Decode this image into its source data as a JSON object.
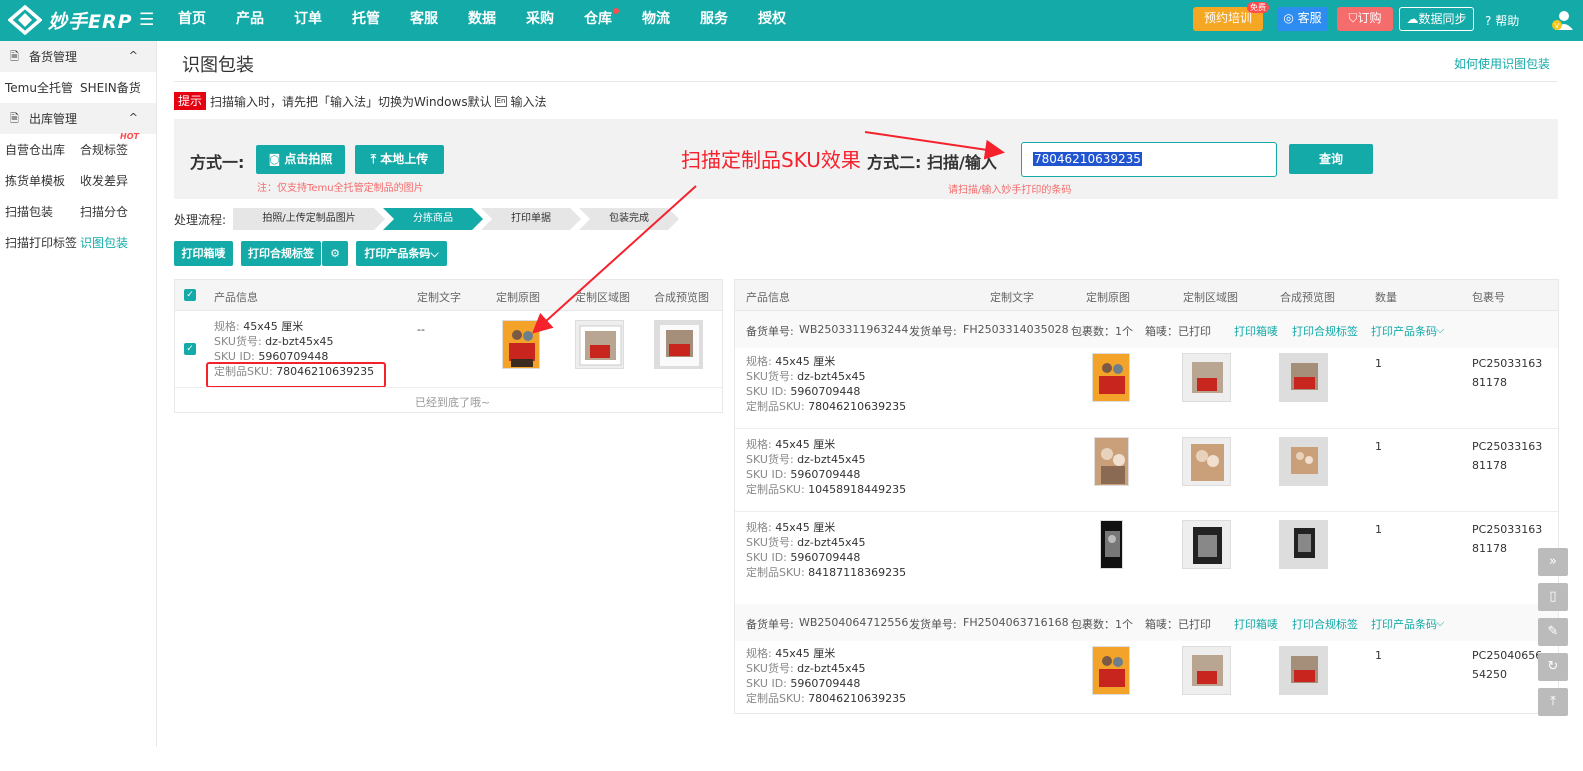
{
  "topbar": {
    "logo_text": "妙手ERP",
    "nav": [
      "首页",
      "产品",
      "订单",
      "托管",
      "客服",
      "数据",
      "采购",
      "仓库",
      "物流",
      "服务",
      "授权"
    ],
    "train_label": "预约培训",
    "free_badge": "免费",
    "service_label": "客服",
    "order_label": "订购",
    "sync_label": "数据同步",
    "help_label": "帮助"
  },
  "sidebar": {
    "group1": "备货管理",
    "row1": [
      "Temu全托管",
      "SHEIN备货"
    ],
    "group2": "出库管理",
    "rows": [
      [
        "自营仓出库",
        "合规标签"
      ],
      [
        "拣货单模板",
        "收发差异"
      ],
      [
        "扫描包装",
        "扫描分仓"
      ],
      [
        "扫描打印标签",
        "识图包装"
      ]
    ],
    "hot": "HOT"
  },
  "page": {
    "title": "识图包装",
    "help_link": "如何使用识图包装",
    "tip_badge": "提示",
    "tip_text1": "扫描输入时，请先把「输入法」切换为Windows默认",
    "tip_kbd": "En",
    "tip_text2": "输入法"
  },
  "scan": {
    "m1_label": "方式一:",
    "photo_btn": "点击拍照",
    "upload_btn": "本地上传",
    "m1_note": "注：仅支持Temu全托管定制品的图片",
    "annotation": "扫描定制品SKU效果",
    "m2_label": "方式二: 扫描/输入",
    "input_value": "78046210639235",
    "query_btn": "查询",
    "m2_note": "请扫描/输入妙手打印的条码"
  },
  "flow": {
    "label": "处理流程:",
    "steps": [
      "拍照/上传定制品图片",
      "分拣商品",
      "打印单据",
      "包装完成"
    ]
  },
  "actions": {
    "print_box": "打印箱唛",
    "print_compliance": "打印合规标签",
    "print_barcode": "打印产品条码"
  },
  "left_table": {
    "headers": [
      "产品信息",
      "定制文字",
      "定制原图",
      "定制区域图",
      "合成预览图"
    ],
    "row": {
      "spec_k": "规格:",
      "spec": "45x45 厘米",
      "skuno_k": "SKU货号:",
      "skuno": "dz-bzt45x45",
      "skuid_k": "SKU ID:",
      "skuid": "5960709448",
      "csku_k": "定制品SKU:",
      "csku": "78046210639235",
      "text": "--"
    },
    "end_msg": "已经到底了哦~"
  },
  "right_table": {
    "headers": [
      "产品信息",
      "定制文字",
      "定制原图",
      "定制区域图",
      "合成预览图",
      "数量",
      "包裹号"
    ],
    "groups": [
      {
        "stock_k": "备货单号:",
        "stock": "WB2503311963244",
        "ship_k": "发货单号:",
        "ship": "FH2503314035028",
        "pkgs": "包裹数：1个",
        "mark": "箱唛：已打印",
        "l1": "打印箱唛",
        "l2": "打印合规标签",
        "l3": "打印产品条码",
        "items": [
          {
            "spec": "45x45 厘米",
            "skuno": "dz-bzt45x45",
            "skuid": "5960709448",
            "csku": "78046210639235",
            "qty": "1",
            "pkg1": "PC25033163",
            "pkg2": "81178"
          },
          {
            "spec": "45x45 厘米",
            "skuno": "dz-bzt45x45",
            "skuid": "5960709448",
            "csku": "10458918449235",
            "qty": "1",
            "pkg1": "PC25033163",
            "pkg2": "81178"
          },
          {
            "spec": "45x45 厘米",
            "skuno": "dz-bzt45x45",
            "skuid": "5960709448",
            "csku": "84187118369235",
            "qty": "1",
            "pkg1": "PC25033163",
            "pkg2": "81178"
          }
        ]
      },
      {
        "stock_k": "备货单号:",
        "stock": "WB2504064712556",
        "ship_k": "发货单号:",
        "ship": "FH2504063716168",
        "pkgs": "包裹数：1个",
        "mark": "箱唛：已打印",
        "l1": "打印箱唛",
        "l2": "打印合规标签",
        "l3": "打印产品条码",
        "items": [
          {
            "spec": "45x45 厘米",
            "skuno": "dz-bzt45x45",
            "skuid": "5960709448",
            "csku": "78046210639235",
            "qty": "1",
            "pkg1": "PC25040656",
            "pkg2": "54250"
          }
        ]
      }
    ],
    "keys": {
      "spec": "规格:",
      "skuno": "SKU货号:",
      "skuid": "SKU ID:",
      "csku": "定制品SKU:"
    }
  },
  "colors": {
    "brand": "#13aaa8",
    "danger": "#f5222d"
  }
}
